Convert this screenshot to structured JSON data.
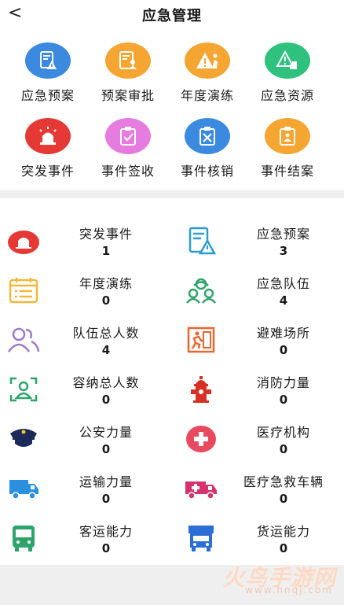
{
  "nav": {
    "back_icon": "chevron-left-icon",
    "back_glyph": "<",
    "title": "应急管理"
  },
  "grid": [
    {
      "label": "应急预案",
      "icon": "plan-document-icon",
      "color": "#3b8ae0"
    },
    {
      "label": "预案审批",
      "icon": "approval-doc-icon",
      "color": "#f5a531"
    },
    {
      "label": "年度演练",
      "icon": "drill-warning-icon",
      "color": "#f5a531"
    },
    {
      "label": "应急资源",
      "icon": "resource-warning-icon",
      "color": "#2ec27e"
    },
    {
      "label": "突发事件",
      "icon": "siren-icon",
      "color": "#e53935"
    },
    {
      "label": "事件签收",
      "icon": "sign-clipboard-icon",
      "color": "#e67be0"
    },
    {
      "label": "事件核销",
      "icon": "cancel-clipboard-icon",
      "color": "#3b8ae0"
    },
    {
      "label": "事件结案",
      "icon": "close-case-clipboard-icon",
      "color": "#f5a531"
    }
  ],
  "stats": [
    {
      "label": "突发事件",
      "value": "1",
      "icon": "siren-icon"
    },
    {
      "label": "应急预案",
      "value": "3",
      "icon": "plan-document-icon"
    },
    {
      "label": "年度演练",
      "value": "0",
      "icon": "calendar-list-icon"
    },
    {
      "label": "应急队伍",
      "value": "4",
      "icon": "team-icon"
    },
    {
      "label": "队伍总人数",
      "value": "4",
      "icon": "people-icon"
    },
    {
      "label": "避难场所",
      "value": "0",
      "icon": "shelter-exit-icon"
    },
    {
      "label": "容纳总人数",
      "value": "0",
      "icon": "capacity-person-icon"
    },
    {
      "label": "消防力量",
      "value": "0",
      "icon": "fire-hydrant-icon"
    },
    {
      "label": "公安力量",
      "value": "0",
      "icon": "police-cap-icon"
    },
    {
      "label": "医疗机构",
      "value": "0",
      "icon": "medical-cross-icon"
    },
    {
      "label": "运输力量",
      "value": "0",
      "icon": "transport-truck-icon"
    },
    {
      "label": "医疗急救车辆",
      "value": "0",
      "icon": "ambulance-icon"
    },
    {
      "label": "客运能力",
      "value": "0",
      "icon": "bus-icon"
    },
    {
      "label": "货运能力",
      "value": "0",
      "icon": "freight-truck-icon"
    }
  ],
  "watermark": {
    "brand": "火鸟手游网",
    "url": "www.hnqj.com"
  }
}
